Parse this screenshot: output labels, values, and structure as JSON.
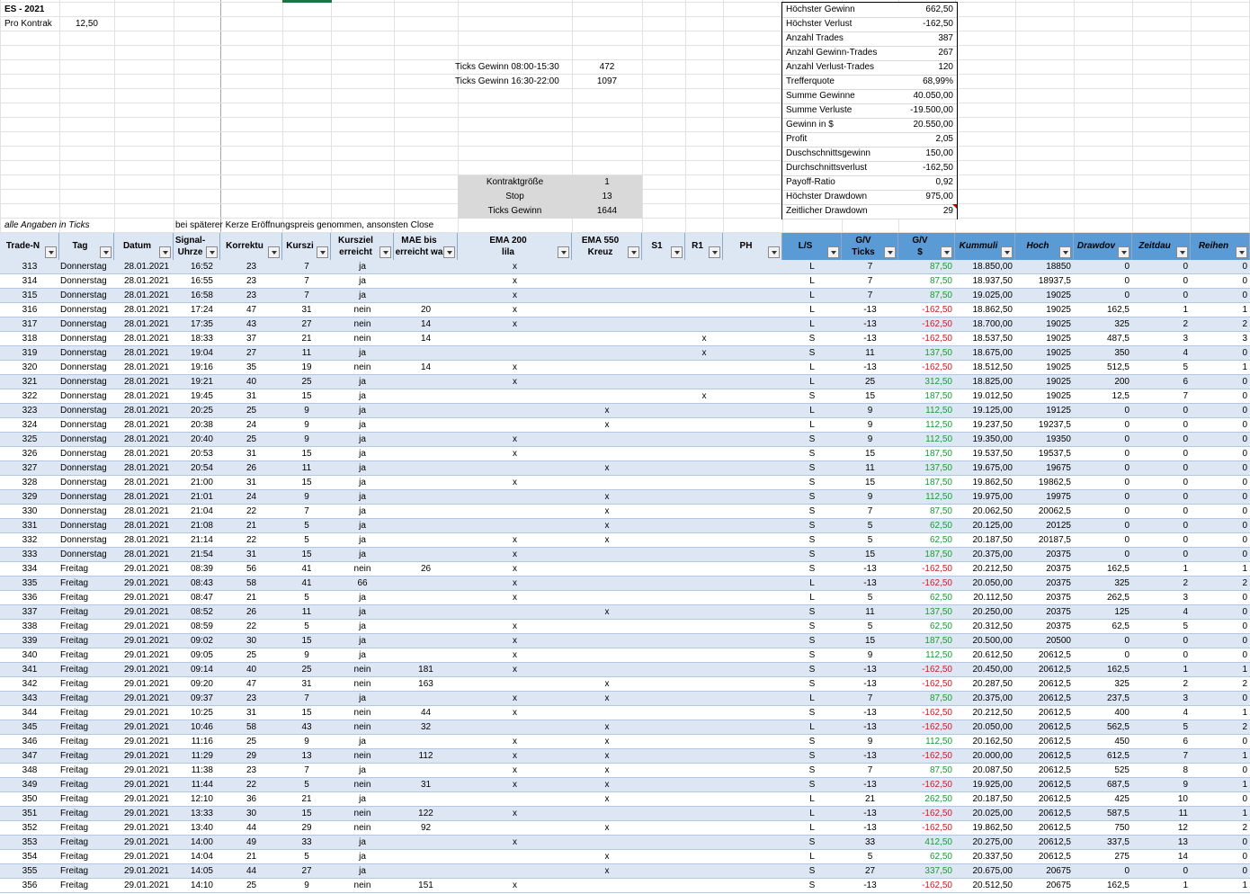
{
  "top": {
    "title": "ES - 2021",
    "pro_kontrakt_label": "Pro Kontrak",
    "pro_kontrakt_value": "12,50",
    "ticks_gewinn_1_label": "Ticks Gewinn 08:00-15:30",
    "ticks_gewinn_1_value": "472",
    "ticks_gewinn_2_label": "Ticks Gewinn 16:30-22:00",
    "ticks_gewinn_2_value": "1097",
    "kontraktgroesse_label": "Kontraktgröße",
    "kontraktgroesse_value": "1",
    "stop_label": "Stop",
    "stop_value": "13",
    "ticks_gewinn_label": "Ticks Gewinn",
    "ticks_gewinn_value": "1644",
    "note_ticks": "alle Angaben in Ticks",
    "note_close": "bei späterer Kerze Eröffnungspreis genommen, ansonsten Close"
  },
  "stats": [
    {
      "label": "Höchster Gewinn",
      "value": "662,50"
    },
    {
      "label": "Höchster Verlust",
      "value": "-162,50"
    },
    {
      "label": "Anzahl Trades",
      "value": "387"
    },
    {
      "label": "Anzahl Gewinn-Trades",
      "value": "267"
    },
    {
      "label": "Anzahl Verlust-Trades",
      "value": "120"
    },
    {
      "label": "Trefferquote",
      "value": "68,99%"
    },
    {
      "label": "Summe Gewinne",
      "value": "40.050,00"
    },
    {
      "label": "Summe Verluste",
      "value": "-19.500,00"
    },
    {
      "label": "Gewinn in $",
      "value": "20.550,00"
    },
    {
      "label": "Profit",
      "value": "2,05"
    },
    {
      "label": "Duschschnittsgewinn",
      "value": "150,00"
    },
    {
      "label": "Durchschnittsverlust",
      "value": "-162,50"
    },
    {
      "label": "Payoff-Ratio",
      "value": "0,92"
    },
    {
      "label": "Höchster Drawdown",
      "value": "975,00"
    },
    {
      "label": "Zeitlicher Drawdown",
      "value": "29"
    }
  ],
  "headers": [
    {
      "l1": "Trade-N",
      "l2": ""
    },
    {
      "l1": "Tag",
      "l2": ""
    },
    {
      "l1": "Datum",
      "l2": ""
    },
    {
      "l1": "Signal-",
      "l2": "Uhrze"
    },
    {
      "l1": "Korrektu",
      "l2": ""
    },
    {
      "l1": "Kurszi",
      "l2": ""
    },
    {
      "l1": "Kursziel",
      "l2": "erreicht"
    },
    {
      "l1": "MAE bis",
      "l2": "erreicht wa"
    },
    {
      "l1": "EMA 200",
      "l2": "lila"
    },
    {
      "l1": "EMA 550",
      "l2": "Kreuz"
    },
    {
      "l1": "S1",
      "l2": ""
    },
    {
      "l1": "R1",
      "l2": ""
    },
    {
      "l1": "PH",
      "l2": ""
    },
    {
      "l1": "L/S",
      "l2": ""
    },
    {
      "l1": "G/V",
      "l2": "Ticks"
    },
    {
      "l1": "G/V",
      "l2": "$"
    },
    {
      "l1": "Kummuli",
      "l2": ""
    },
    {
      "l1": "Hoch",
      "l2": ""
    },
    {
      "l1": "Drawdov",
      "l2": ""
    },
    {
      "l1": "Zeitdau",
      "l2": ""
    },
    {
      "l1": "Reihen",
      "l2": ""
    }
  ],
  "rows": [
    [
      "313",
      "Donnerstag",
      "28.01.2021",
      "16:52",
      "23",
      "7",
      "ja",
      "",
      "x",
      "",
      "",
      "",
      "",
      "L",
      "7",
      "87,50",
      "18.850,00",
      "18850",
      "0",
      "0",
      "0"
    ],
    [
      "314",
      "Donnerstag",
      "28.01.2021",
      "16:55",
      "23",
      "7",
      "ja",
      "",
      "x",
      "",
      "",
      "",
      "",
      "L",
      "7",
      "87,50",
      "18.937,50",
      "18937,5",
      "0",
      "0",
      "0"
    ],
    [
      "315",
      "Donnerstag",
      "28.01.2021",
      "16:58",
      "23",
      "7",
      "ja",
      "",
      "x",
      "",
      "",
      "",
      "",
      "L",
      "7",
      "87,50",
      "19.025,00",
      "19025",
      "0",
      "0",
      "0"
    ],
    [
      "316",
      "Donnerstag",
      "28.01.2021",
      "17:24",
      "47",
      "31",
      "nein",
      "20",
      "x",
      "",
      "",
      "",
      "",
      "L",
      "-13",
      "-162,50",
      "18.862,50",
      "19025",
      "162,5",
      "1",
      "1"
    ],
    [
      "317",
      "Donnerstag",
      "28.01.2021",
      "17:35",
      "43",
      "27",
      "nein",
      "14",
      "x",
      "",
      "",
      "",
      "",
      "L",
      "-13",
      "-162,50",
      "18.700,00",
      "19025",
      "325",
      "2",
      "2"
    ],
    [
      "318",
      "Donnerstag",
      "28.01.2021",
      "18:33",
      "37",
      "21",
      "nein",
      "14",
      "",
      "",
      "",
      "x",
      "",
      "S",
      "-13",
      "-162,50",
      "18.537,50",
      "19025",
      "487,5",
      "3",
      "3"
    ],
    [
      "319",
      "Donnerstag",
      "28.01.2021",
      "19:04",
      "27",
      "11",
      "ja",
      "",
      "",
      "",
      "",
      "x",
      "",
      "S",
      "11",
      "137,50",
      "18.675,00",
      "19025",
      "350",
      "4",
      "0"
    ],
    [
      "320",
      "Donnerstag",
      "28.01.2021",
      "19:16",
      "35",
      "19",
      "nein",
      "14",
      "x",
      "",
      "",
      "",
      "",
      "L",
      "-13",
      "-162,50",
      "18.512,50",
      "19025",
      "512,5",
      "5",
      "1"
    ],
    [
      "321",
      "Donnerstag",
      "28.01.2021",
      "19:21",
      "40",
      "25",
      "ja",
      "",
      "x",
      "",
      "",
      "",
      "",
      "L",
      "25",
      "312,50",
      "18.825,00",
      "19025",
      "200",
      "6",
      "0"
    ],
    [
      "322",
      "Donnerstag",
      "28.01.2021",
      "19:45",
      "31",
      "15",
      "ja",
      "",
      "",
      "",
      "",
      "x",
      "",
      "S",
      "15",
      "187,50",
      "19.012,50",
      "19025",
      "12,5",
      "7",
      "0"
    ],
    [
      "323",
      "Donnerstag",
      "28.01.2021",
      "20:25",
      "25",
      "9",
      "ja",
      "",
      "",
      "x",
      "",
      "",
      "",
      "L",
      "9",
      "112,50",
      "19.125,00",
      "19125",
      "0",
      "0",
      "0"
    ],
    [
      "324",
      "Donnerstag",
      "28.01.2021",
      "20:38",
      "24",
      "9",
      "ja",
      "",
      "",
      "x",
      "",
      "",
      "",
      "L",
      "9",
      "112,50",
      "19.237,50",
      "19237,5",
      "0",
      "0",
      "0"
    ],
    [
      "325",
      "Donnerstag",
      "28.01.2021",
      "20:40",
      "25",
      "9",
      "ja",
      "",
      "x",
      "",
      "",
      "",
      "",
      "S",
      "9",
      "112,50",
      "19.350,00",
      "19350",
      "0",
      "0",
      "0"
    ],
    [
      "326",
      "Donnerstag",
      "28.01.2021",
      "20:53",
      "31",
      "15",
      "ja",
      "",
      "x",
      "",
      "",
      "",
      "",
      "S",
      "15",
      "187,50",
      "19.537,50",
      "19537,5",
      "0",
      "0",
      "0"
    ],
    [
      "327",
      "Donnerstag",
      "28.01.2021",
      "20:54",
      "26",
      "11",
      "ja",
      "",
      "",
      "x",
      "",
      "",
      "",
      "S",
      "11",
      "137,50",
      "19.675,00",
      "19675",
      "0",
      "0",
      "0"
    ],
    [
      "328",
      "Donnerstag",
      "28.01.2021",
      "21:00",
      "31",
      "15",
      "ja",
      "",
      "x",
      "",
      "",
      "",
      "",
      "S",
      "15",
      "187,50",
      "19.862,50",
      "19862,5",
      "0",
      "0",
      "0"
    ],
    [
      "329",
      "Donnerstag",
      "28.01.2021",
      "21:01",
      "24",
      "9",
      "ja",
      "",
      "",
      "x",
      "",
      "",
      "",
      "S",
      "9",
      "112,50",
      "19.975,00",
      "19975",
      "0",
      "0",
      "0"
    ],
    [
      "330",
      "Donnerstag",
      "28.01.2021",
      "21:04",
      "22",
      "7",
      "ja",
      "",
      "",
      "x",
      "",
      "",
      "",
      "S",
      "7",
      "87,50",
      "20.062,50",
      "20062,5",
      "0",
      "0",
      "0"
    ],
    [
      "331",
      "Donnerstag",
      "28.01.2021",
      "21:08",
      "21",
      "5",
      "ja",
      "",
      "",
      "x",
      "",
      "",
      "",
      "S",
      "5",
      "62,50",
      "20.125,00",
      "20125",
      "0",
      "0",
      "0"
    ],
    [
      "332",
      "Donnerstag",
      "28.01.2021",
      "21:14",
      "22",
      "5",
      "ja",
      "",
      "x",
      "x",
      "",
      "",
      "",
      "S",
      "5",
      "62,50",
      "20.187,50",
      "20187,5",
      "0",
      "0",
      "0"
    ],
    [
      "333",
      "Donnerstag",
      "28.01.2021",
      "21:54",
      "31",
      "15",
      "ja",
      "",
      "x",
      "",
      "",
      "",
      "",
      "S",
      "15",
      "187,50",
      "20.375,00",
      "20375",
      "0",
      "0",
      "0"
    ],
    [
      "334",
      "Freitag",
      "29.01.2021",
      "08:39",
      "56",
      "41",
      "nein",
      "26",
      "x",
      "",
      "",
      "",
      "",
      "S",
      "-13",
      "-162,50",
      "20.212,50",
      "20375",
      "162,5",
      "1",
      "1"
    ],
    [
      "335",
      "Freitag",
      "29.01.2021",
      "08:43",
      "58",
      "41",
      "66",
      "",
      "x",
      "",
      "",
      "",
      "",
      "L",
      "-13",
      "-162,50",
      "20.050,00",
      "20375",
      "325",
      "2",
      "2"
    ],
    [
      "336",
      "Freitag",
      "29.01.2021",
      "08:47",
      "21",
      "5",
      "ja",
      "",
      "x",
      "",
      "",
      "",
      "",
      "L",
      "5",
      "62,50",
      "20.112,50",
      "20375",
      "262,5",
      "3",
      "0"
    ],
    [
      "337",
      "Freitag",
      "29.01.2021",
      "08:52",
      "26",
      "11",
      "ja",
      "",
      "",
      "x",
      "",
      "",
      "",
      "S",
      "11",
      "137,50",
      "20.250,00",
      "20375",
      "125",
      "4",
      "0"
    ],
    [
      "338",
      "Freitag",
      "29.01.2021",
      "08:59",
      "22",
      "5",
      "ja",
      "",
      "x",
      "",
      "",
      "",
      "",
      "S",
      "5",
      "62,50",
      "20.312,50",
      "20375",
      "62,5",
      "5",
      "0"
    ],
    [
      "339",
      "Freitag",
      "29.01.2021",
      "09:02",
      "30",
      "15",
      "ja",
      "",
      "x",
      "",
      "",
      "",
      "",
      "S",
      "15",
      "187,50",
      "20.500,00",
      "20500",
      "0",
      "0",
      "0"
    ],
    [
      "340",
      "Freitag",
      "29.01.2021",
      "09:05",
      "25",
      "9",
      "ja",
      "",
      "x",
      "",
      "",
      "",
      "",
      "S",
      "9",
      "112,50",
      "20.612,50",
      "20612,5",
      "0",
      "0",
      "0"
    ],
    [
      "341",
      "Freitag",
      "29.01.2021",
      "09:14",
      "40",
      "25",
      "nein",
      "181",
      "x",
      "",
      "",
      "",
      "",
      "S",
      "-13",
      "-162,50",
      "20.450,00",
      "20612,5",
      "162,5",
      "1",
      "1"
    ],
    [
      "342",
      "Freitag",
      "29.01.2021",
      "09:20",
      "47",
      "31",
      "nein",
      "163",
      "",
      "x",
      "",
      "",
      "",
      "S",
      "-13",
      "-162,50",
      "20.287,50",
      "20612,5",
      "325",
      "2",
      "2"
    ],
    [
      "343",
      "Freitag",
      "29.01.2021",
      "09:37",
      "23",
      "7",
      "ja",
      "",
      "x",
      "x",
      "",
      "",
      "",
      "L",
      "7",
      "87,50",
      "20.375,00",
      "20612,5",
      "237,5",
      "3",
      "0"
    ],
    [
      "344",
      "Freitag",
      "29.01.2021",
      "10:25",
      "31",
      "15",
      "nein",
      "44",
      "x",
      "",
      "",
      "",
      "",
      "S",
      "-13",
      "-162,50",
      "20.212,50",
      "20612,5",
      "400",
      "4",
      "1"
    ],
    [
      "345",
      "Freitag",
      "29.01.2021",
      "10:46",
      "58",
      "43",
      "nein",
      "32",
      "",
      "x",
      "",
      "",
      "",
      "L",
      "-13",
      "-162,50",
      "20.050,00",
      "20612,5",
      "562,5",
      "5",
      "2"
    ],
    [
      "346",
      "Freitag",
      "29.01.2021",
      "11:16",
      "25",
      "9",
      "ja",
      "",
      "x",
      "x",
      "",
      "",
      "",
      "S",
      "9",
      "112,50",
      "20.162,50",
      "20612,5",
      "450",
      "6",
      "0"
    ],
    [
      "347",
      "Freitag",
      "29.01.2021",
      "11:29",
      "29",
      "13",
      "nein",
      "112",
      "x",
      "x",
      "",
      "",
      "",
      "S",
      "-13",
      "-162,50",
      "20.000,00",
      "20612,5",
      "612,5",
      "7",
      "1"
    ],
    [
      "348",
      "Freitag",
      "29.01.2021",
      "11:38",
      "23",
      "7",
      "ja",
      "",
      "x",
      "x",
      "",
      "",
      "",
      "S",
      "7",
      "87,50",
      "20.087,50",
      "20612,5",
      "525",
      "8",
      "0"
    ],
    [
      "349",
      "Freitag",
      "29.01.2021",
      "11:44",
      "22",
      "5",
      "nein",
      "31",
      "x",
      "x",
      "",
      "",
      "",
      "S",
      "-13",
      "-162,50",
      "19.925,00",
      "20612,5",
      "687,5",
      "9",
      "1"
    ],
    [
      "350",
      "Freitag",
      "29.01.2021",
      "12:10",
      "36",
      "21",
      "ja",
      "",
      "",
      "x",
      "",
      "",
      "",
      "L",
      "21",
      "262,50",
      "20.187,50",
      "20612,5",
      "425",
      "10",
      "0"
    ],
    [
      "351",
      "Freitag",
      "29.01.2021",
      "13:33",
      "30",
      "15",
      "nein",
      "122",
      "x",
      "",
      "",
      "",
      "",
      "L",
      "-13",
      "-162,50",
      "20.025,00",
      "20612,5",
      "587,5",
      "11",
      "1"
    ],
    [
      "352",
      "Freitag",
      "29.01.2021",
      "13:40",
      "44",
      "29",
      "nein",
      "92",
      "",
      "x",
      "",
      "",
      "",
      "L",
      "-13",
      "-162,50",
      "19.862,50",
      "20612,5",
      "750",
      "12",
      "2"
    ],
    [
      "353",
      "Freitag",
      "29.01.2021",
      "14:00",
      "49",
      "33",
      "ja",
      "",
      "x",
      "",
      "",
      "",
      "",
      "S",
      "33",
      "412,50",
      "20.275,00",
      "20612,5",
      "337,5",
      "13",
      "0"
    ],
    [
      "354",
      "Freitag",
      "29.01.2021",
      "14:04",
      "21",
      "5",
      "ja",
      "",
      "",
      "x",
      "",
      "",
      "",
      "L",
      "5",
      "62,50",
      "20.337,50",
      "20612,5",
      "275",
      "14",
      "0"
    ],
    [
      "355",
      "Freitag",
      "29.01.2021",
      "14:05",
      "44",
      "27",
      "ja",
      "",
      "",
      "x",
      "",
      "",
      "",
      "S",
      "27",
      "337,50",
      "20.675,00",
      "20675",
      "0",
      "0",
      "0"
    ],
    [
      "356",
      "Freitag",
      "29.01.2021",
      "14:10",
      "25",
      "9",
      "nein",
      "151",
      "x",
      "",
      "",
      "",
      "",
      "S",
      "-13",
      "-162,50",
      "20.512,50",
      "20675",
      "162,5",
      "1",
      "1"
    ]
  ],
  "colors": {
    "header_light": "#dde7f3",
    "header_dark": "#5b9bd5",
    "row_alt": "#dde7f3",
    "positive": "#1a9b2e",
    "negative": "#d0191f"
  }
}
